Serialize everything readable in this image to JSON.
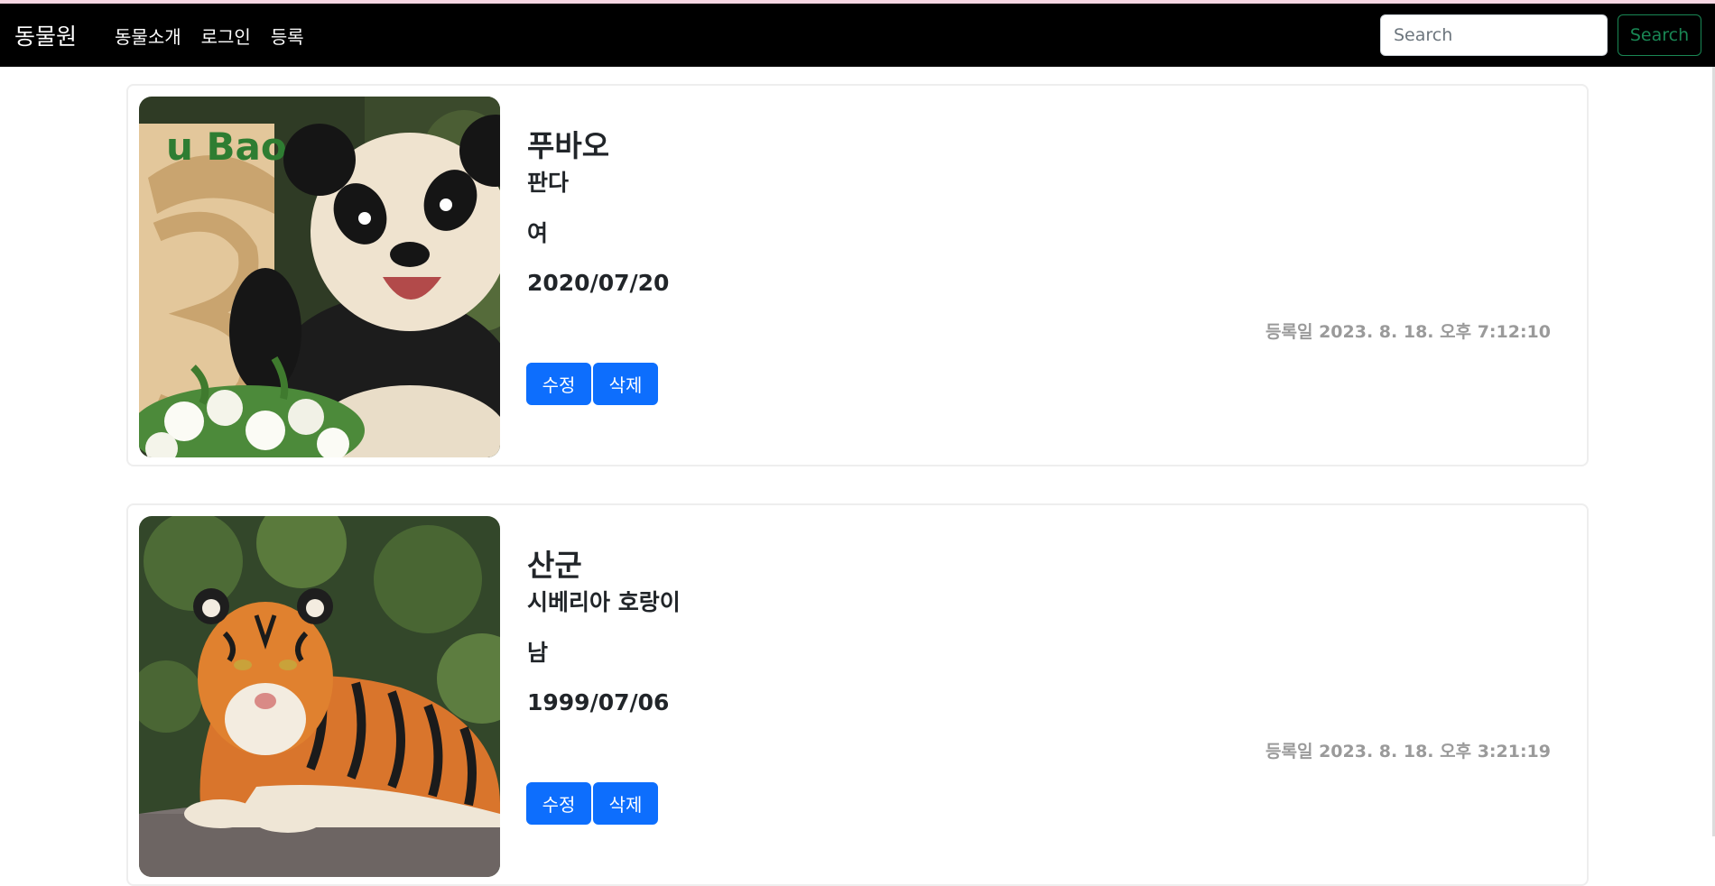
{
  "navbar": {
    "brand": "동물원",
    "links": [
      "동물소개",
      "로그인",
      "등록"
    ],
    "search_placeholder": "Search",
    "search_button": "Search"
  },
  "animals": [
    {
      "name": "푸바오",
      "species": "판다",
      "gender": "여",
      "birth": "2020/07/20",
      "registered": "등록일 2023. 8. 18. 오후 7:12:10",
      "edit_label": "수정",
      "delete_label": "삭제",
      "image": "panda-photo"
    },
    {
      "name": "산군",
      "species": "시베리아 호랑이",
      "gender": "남",
      "birth": "1999/07/06",
      "registered": "등록일 2023. 8. 18. 오후 3:21:19",
      "edit_label": "수정",
      "delete_label": "삭제",
      "image": "tiger-photo"
    }
  ],
  "colors": {
    "navbar_bg": "#000000",
    "primary": "#0d6efd",
    "search_outline": "#198754",
    "muted_text": "#9a9a9a"
  }
}
